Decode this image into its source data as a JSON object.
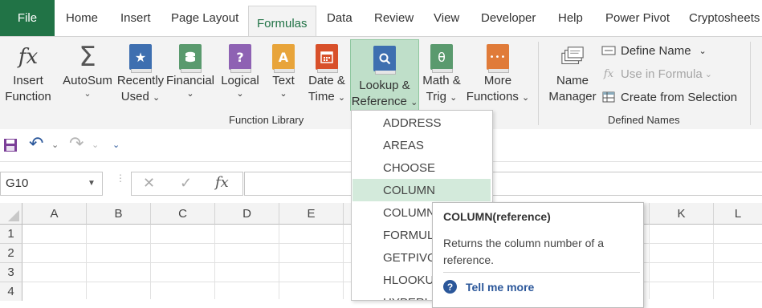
{
  "tabs": {
    "file": "File",
    "items": [
      "Home",
      "Insert",
      "Page Layout",
      "Formulas",
      "Data",
      "Review",
      "View",
      "Developer",
      "Help",
      "Power Pivot",
      "Cryptosheets"
    ],
    "active": "Formulas"
  },
  "ribbon": {
    "insert_function": {
      "line1": "Insert",
      "line2": "Function",
      "icon": "fx-icon"
    },
    "autosum": {
      "label": "AutoSum",
      "icon": "sigma-icon"
    },
    "recently_used": {
      "line1": "Recently",
      "line2": "Used",
      "icon": "star-book-icon"
    },
    "financial": {
      "label": "Financial",
      "icon": "coins-book-icon"
    },
    "logical": {
      "label": "Logical",
      "icon": "question-book-icon"
    },
    "text": {
      "label": "Text",
      "icon": "letter-a-book-icon"
    },
    "date_time": {
      "line1": "Date &",
      "line2": "Time",
      "icon": "calendar-book-icon"
    },
    "lookup_reference": {
      "line1": "Lookup &",
      "line2": "Reference",
      "icon": "magnifier-book-icon"
    },
    "math_trig": {
      "line1": "Math &",
      "line2": "Trig",
      "icon": "theta-book-icon"
    },
    "more_functions": {
      "line1": "More",
      "line2": "Functions",
      "icon": "dots-book-icon"
    },
    "function_library_label": "Function Library",
    "name_manager": {
      "line1": "Name",
      "line2": "Manager",
      "icon": "name-tags-icon"
    },
    "define_name": "Define Name",
    "use_in_formula": "Use in Formula",
    "create_from_selection": "Create from Selection",
    "defined_names_label": "Defined Names",
    "glyphs": {
      "fx": "fx",
      "sigma": "Σ",
      "star": "★",
      "question": "?",
      "letter_a": "A",
      "theta": "θ",
      "dots": "•••",
      "caret": "⌄",
      "magnifier": "⚲"
    }
  },
  "qat": {
    "glyphs": {
      "undo": "↶",
      "redo": "↷",
      "customize": "⌄"
    }
  },
  "formula_bar": {
    "name_box": "G10",
    "cancel_glyph": "✕",
    "enter_glyph": "✓",
    "fx_glyph": "fx",
    "formula": ""
  },
  "grid": {
    "columns": [
      "A",
      "B",
      "C",
      "D",
      "E",
      "K",
      "L"
    ],
    "rows": [
      "1",
      "2",
      "3",
      "4"
    ]
  },
  "dropdown": {
    "items": [
      "ADDRESS",
      "AREAS",
      "CHOOSE",
      "COLUMN",
      "COLUMNS",
      "FORMULATEXT",
      "GETPIVOTDATA",
      "HLOOKUP",
      "HYPERLINK"
    ],
    "hovered": "COLUMN"
  },
  "tooltip": {
    "title": "COLUMN(reference)",
    "description": "Returns the column number of a reference.",
    "help_link": "Tell me more",
    "help_glyph": "?"
  },
  "colors": {
    "accent_green": "#217346",
    "active_tab_text": "#217346",
    "hover_bg": "#d3eadb",
    "link_blue": "#2b579a"
  }
}
